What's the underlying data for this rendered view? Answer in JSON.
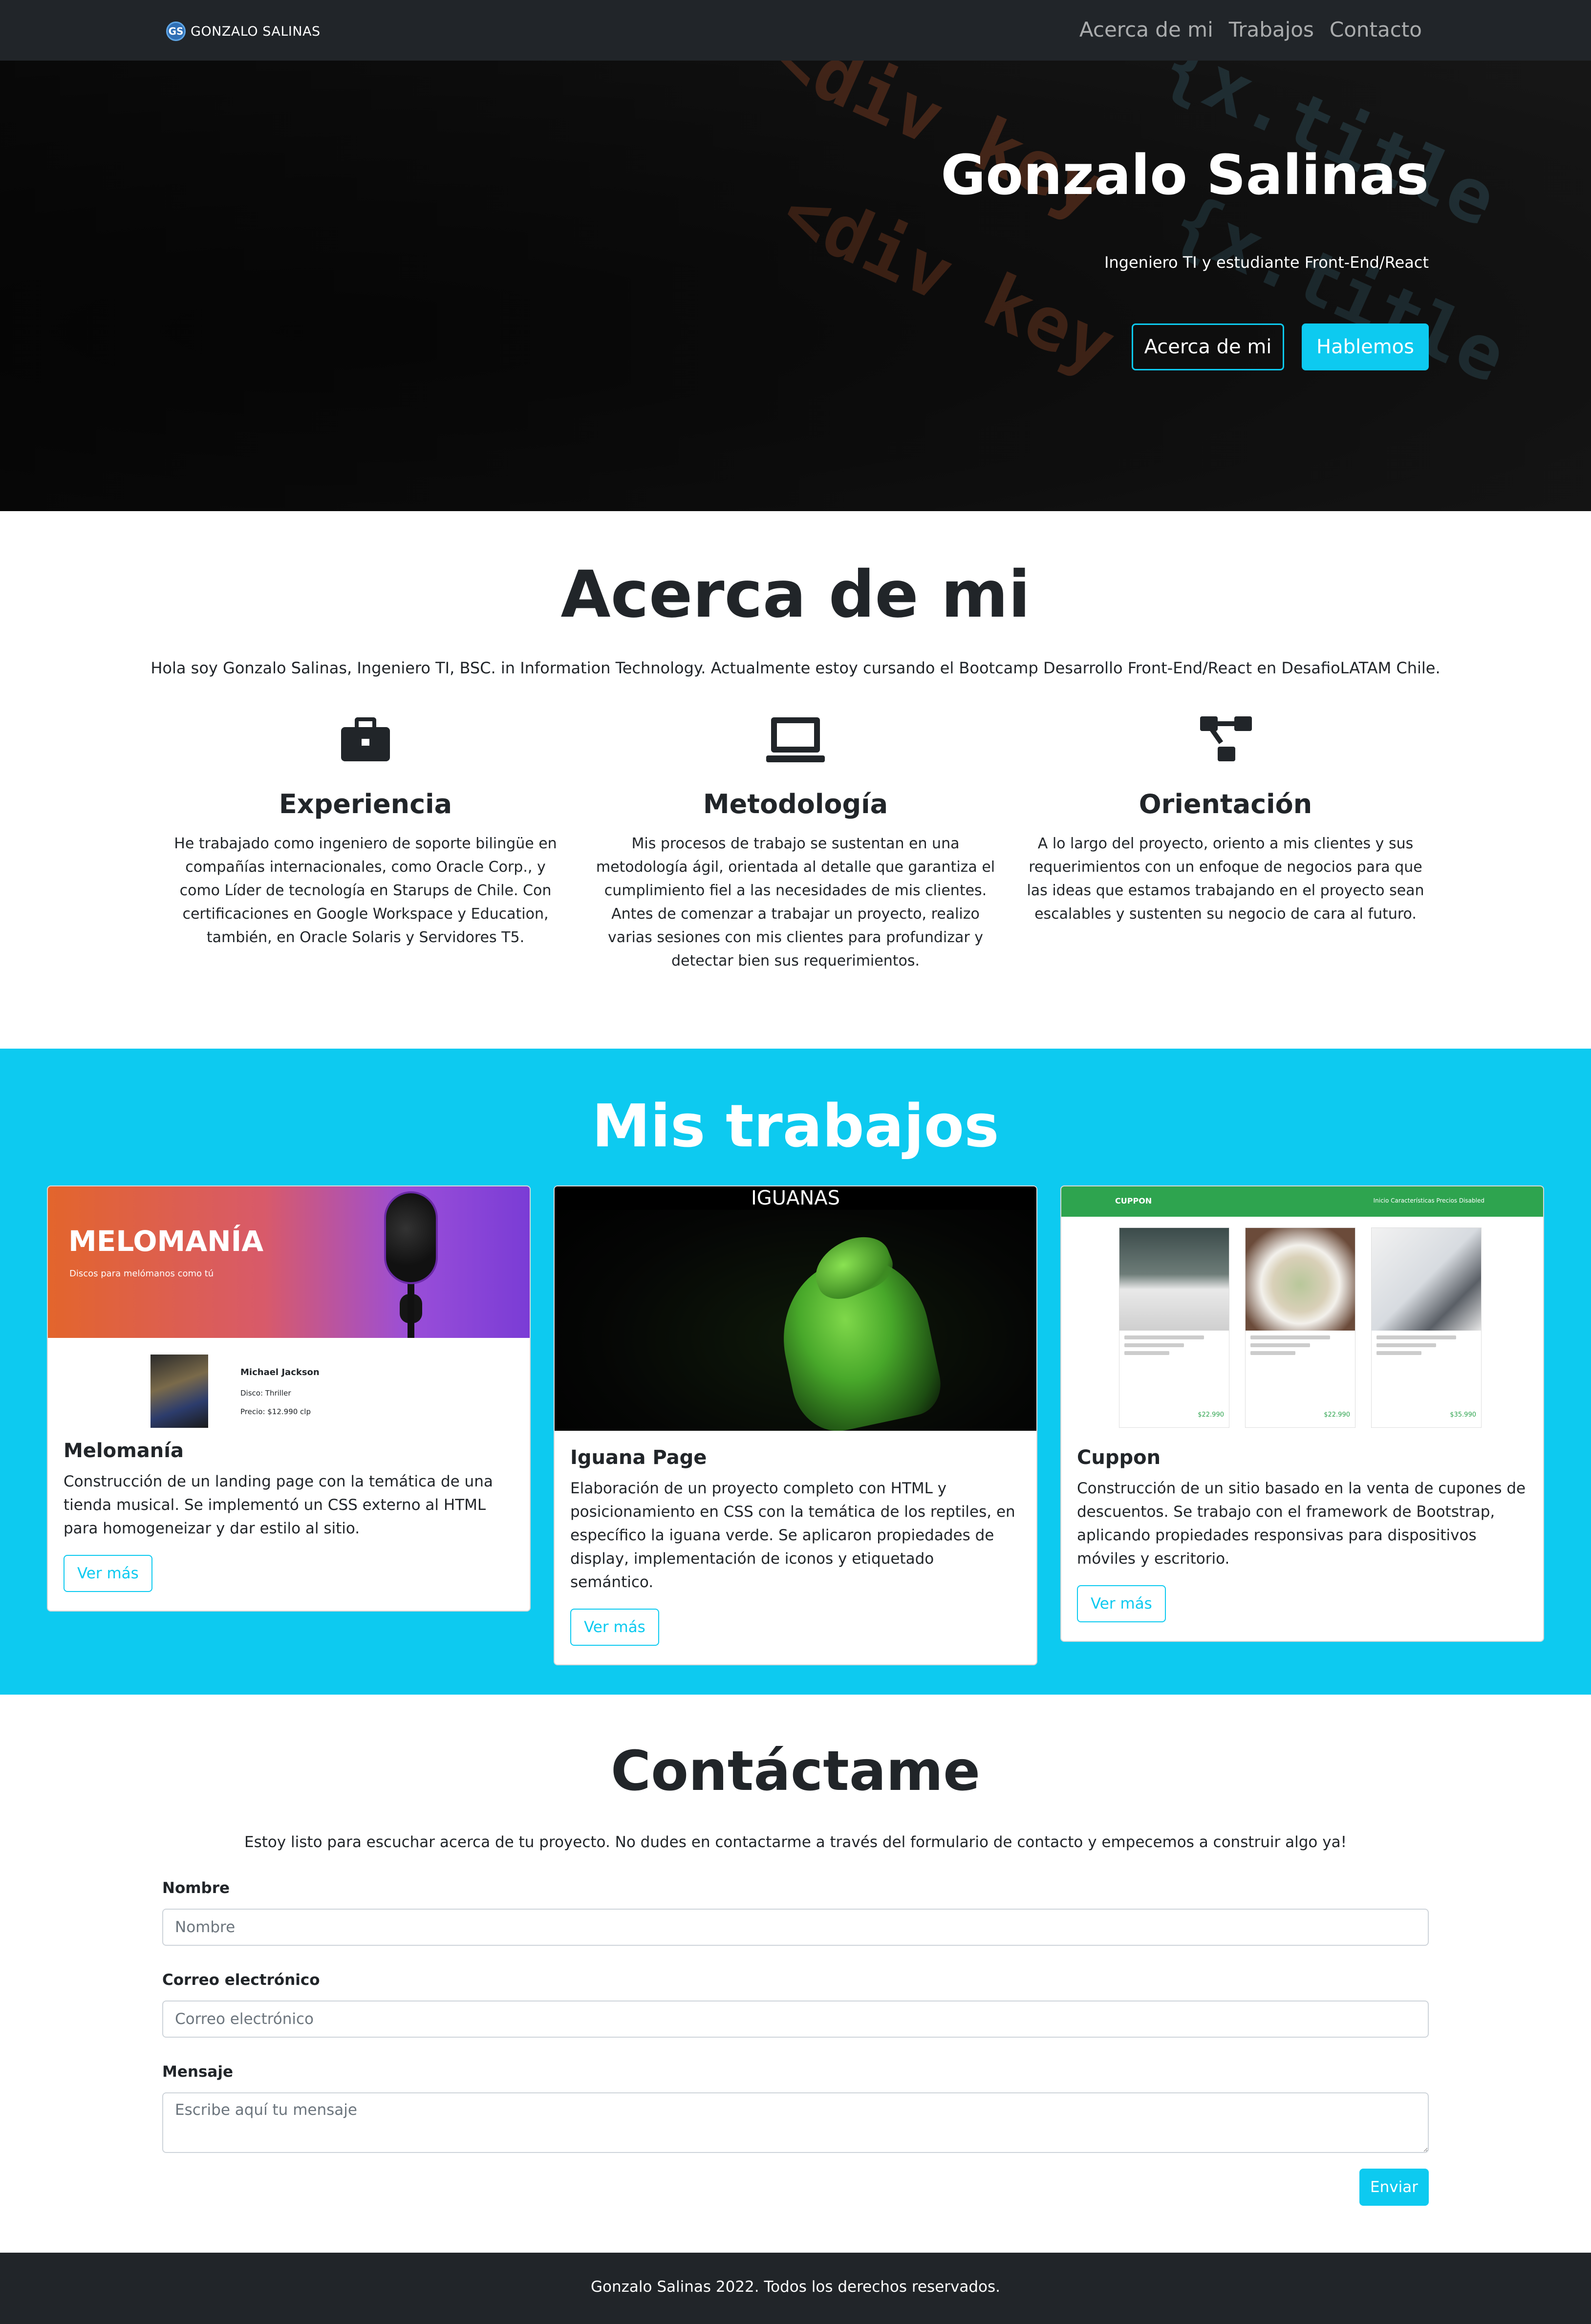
{
  "navbar": {
    "brand_logo": "GS",
    "brand_name": "GONZALO SALINAS",
    "links": [
      "Acerca de mi",
      "Trabajos",
      "Contacto"
    ]
  },
  "hero": {
    "title": "Gonzalo Salinas",
    "subtitle": "Ingeniero TI y estudiante Front-End/React",
    "btn_about": "Acerca de mi",
    "btn_talk": "Hablemos"
  },
  "about": {
    "title": "Acerca de mi",
    "intro": "Hola soy Gonzalo Salinas, Ingeniero TI, BSC. in Information Technology. Actualmente estoy cursando el Bootcamp Desarrollo Front-End/React en DesafioLATAM Chile.",
    "features": [
      {
        "icon": "briefcase-icon",
        "title": "Experiencia",
        "text": "He trabajado como ingeniero de soporte bilingüe en compañías internacionales, como Oracle Corp., y como Líder de tecnología en Starups de Chile. Con certificaciones en Google Workspace y Education, también, en Oracle Solaris y Servidores T5."
      },
      {
        "icon": "laptop-icon",
        "title": "Metodología",
        "text": "Mis procesos de trabajo se sustentan en una metodología ágil, orientada al detalle que garantiza el cumplimiento fiel a las necesidades de mis clientes. Antes de comenzar a trabajar un proyecto, realizo varias sesiones con mis clientes para profundizar y detectar bien sus requerimientos."
      },
      {
        "icon": "diagram-icon",
        "title": "Orientación",
        "text": "A lo largo del proyecto, oriento a mis clientes y sus requerimientos con un enfoque de negocios para que las ideas que estamos trabajando en el proyecto sean escalables y sustenten su negocio de cara al futuro."
      }
    ]
  },
  "works": {
    "title": "Mis trabajos",
    "cards": [
      {
        "title": "Melomanía",
        "text": "Construcción de un landing page con la temática de una tienda musical. Se implementó un CSS externo al HTML para homogeneizar y dar estilo al sitio.",
        "button": "Ver más",
        "preview": {
          "logo": "MELOMANÍA",
          "tagline": "Discos para melómanos como tú",
          "artist": "Michael Jackson",
          "disc": "Disco: Thriller",
          "price": "Precio: $12.990 clp"
        }
      },
      {
        "title": "Iguana Page",
        "text": "Elaboración de un proyecto completo con HTML y posicionamiento en CSS con la temática de los reptiles, en específico la iguana verde. Se aplicaron propiedades de display, implementación de iconos y etiquetado semántico.",
        "button": "Ver más",
        "preview": {
          "heading": "IGUANAS"
        }
      },
      {
        "title": "Cuppon",
        "text": "Construcción de un sitio basado en la venta de cupones de descuentos. Se trabajo con el framework de Bootstrap, aplicando propiedades responsivas para dispositivos móviles y escritorio.",
        "button": "Ver más",
        "preview": {
          "brand": "CUPPON",
          "links": "Inicio  Características  Precios  Disabled",
          "prices": [
            "$22.990",
            "$22.990",
            "$35.990"
          ]
        }
      }
    ]
  },
  "contact": {
    "title": "Contáctame",
    "intro": "Estoy listo para escuchar acerca de tu proyecto. No dudes en contactarme a través del formulario de contacto y empecemos a construir algo ya!",
    "name_label": "Nombre",
    "name_placeholder": "Nombre",
    "email_label": "Correo electrónico",
    "email_placeholder": "Correo electrónico",
    "message_label": "Mensaje",
    "message_placeholder": "Escribe aquí tu mensaje",
    "submit": "Enviar"
  },
  "footer": {
    "text": "Gonzalo Salinas 2022. Todos los derechos reservados."
  },
  "colors": {
    "accent": "#0dcaf0",
    "dark": "#212529",
    "cuppon_green": "#2ea44f"
  }
}
